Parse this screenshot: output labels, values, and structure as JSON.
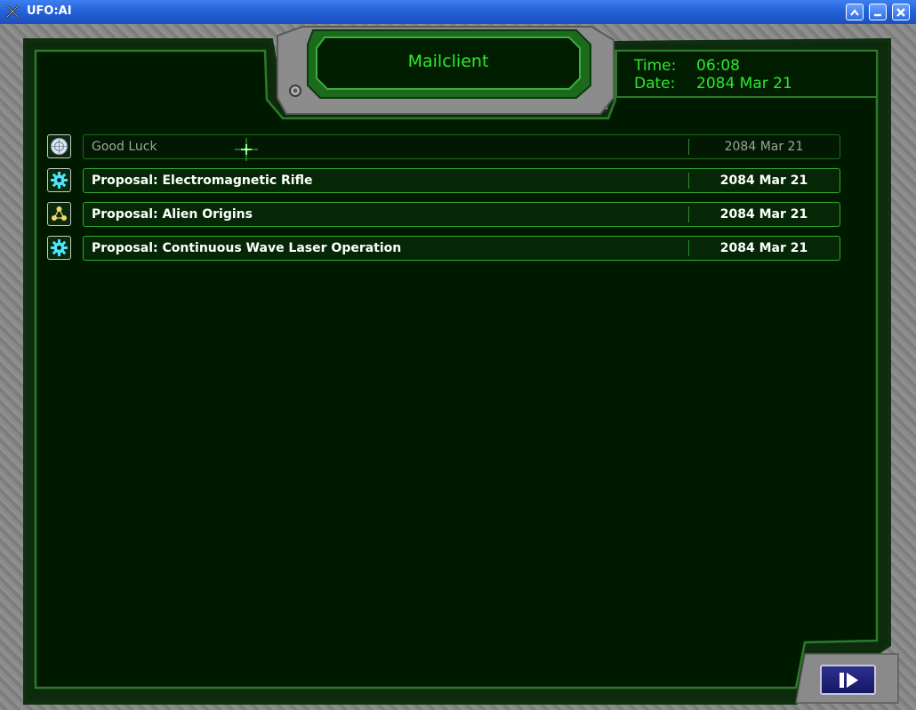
{
  "window": {
    "title": "UFO:AI",
    "controls": [
      "rollup",
      "minimize",
      "close"
    ]
  },
  "header": {
    "title": "Mailclient"
  },
  "clock": {
    "time_label": "Time:",
    "time_value": "06:08",
    "date_label": "Date:",
    "date_value": "2084 Mar 21"
  },
  "mails": [
    {
      "icon": "un-emblem-icon",
      "subject": "Good Luck",
      "date": "2084 Mar 21",
      "read": true
    },
    {
      "icon": "gear-icon",
      "subject": "Proposal: Electromagnetic Rifle",
      "date": "2084 Mar 21",
      "read": false
    },
    {
      "icon": "molecule-icon",
      "subject": "Proposal: Alien Origins",
      "date": "2084 Mar 21",
      "read": false
    },
    {
      "icon": "gear-icon",
      "subject": "Proposal: Continuous Wave Laser Operation",
      "date": "2084 Mar 21",
      "read": false
    }
  ],
  "colors": {
    "accent_green": "#2ee82e",
    "panel_background": "#001a00",
    "button_blue": "#1f2180"
  }
}
